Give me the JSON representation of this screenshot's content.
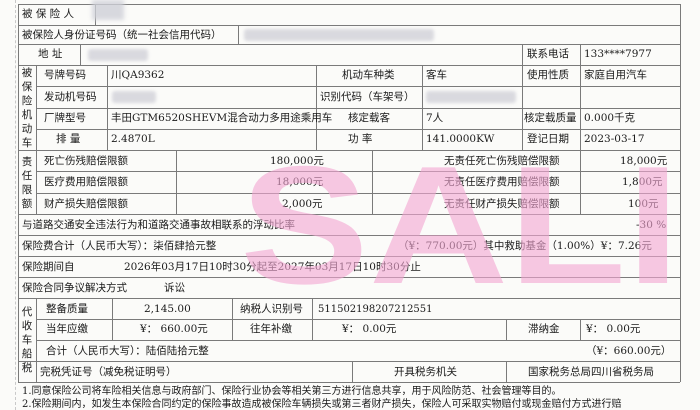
{
  "header": {
    "insured_label": "被 保 险 人",
    "id_label": "被保险人身份证号码（统一社会信用代码）",
    "address_label": "地    址",
    "phone_label": "联系电话",
    "phone_value": "133****7977"
  },
  "vehicle": {
    "section_label": "被保险机动车",
    "plate_label": "号牌号码",
    "plate_value": "川QA9362",
    "kind_label": "机动车种类",
    "kind_value": "客车",
    "use_label": "使用性质",
    "use_value": "家庭自用汽车",
    "engine_label": "发动机号码",
    "vin_label": "识别代码（车架号）",
    "model_label": "厂牌型号",
    "model_value": "丰田GTM6520SHEVM混合动力多用途乘用车",
    "seats_label": "核定载客",
    "seats_value": "7人",
    "load_label": "核定载质量",
    "load_value": "0.000千克",
    "displacement_label": "排    量",
    "displacement_value": "2.4870L",
    "power_label": "功    率",
    "power_value": "141.0000KW",
    "reg_date_label": "登记日期",
    "reg_date_value": "2023-03-17"
  },
  "liability": {
    "section_label": "责任限额",
    "rows": [
      {
        "label": "死亡伤残赔偿限额",
        "value": "180,000元",
        "nf_label": "无责任死亡伤残赔偿限额",
        "nf_value": "18,000元"
      },
      {
        "label": "医疗费用赔偿限额",
        "value": "18,000元",
        "nf_label": "无责任医疗费用赔偿限额",
        "nf_value": "1,800元"
      },
      {
        "label": "财产损失赔偿限额",
        "value": "2,000元",
        "nf_label": "无责任财产损失赔偿限额",
        "nf_value": "100元"
      }
    ]
  },
  "float_rate": {
    "label": "与道路交通安全违法行为和道路交通事故相联系的浮动比率",
    "value": "-30  %"
  },
  "premium": {
    "label": "保险费合计（人民币大写）：柒佰肆拾元整",
    "amount": "（¥：770.00元）其中救助基金（1.00%）¥：7.26元"
  },
  "period": {
    "label": "保险期间自",
    "value": "2026年03月17日10时30分起至2027年03月17日10时30分止"
  },
  "dispute": {
    "label": "保险合同争议解决方式",
    "value": "诉讼"
  },
  "tax": {
    "section_label": "代收车船税",
    "tonnage_label": "整备质量",
    "tonnage_value": "2,145.00",
    "taxpayer_label": "纳税人识别号",
    "taxpayer_value": "511502198207212551",
    "current_label": "当年应缴",
    "current_value": "¥：  660.00元",
    "back_label": "往年补缴",
    "back_value": "¥：      0.00元",
    "late_label": "滞纳金",
    "late_value": "¥：       0.00元",
    "total_label": "合计（人民币大写）：陆佰陆拾元整",
    "total_value": "（¥：660.00元）",
    "cert_label": "完税凭证号（减免税证明号）",
    "office_label": "开具税务机关",
    "office_value": "国家税务总局四川省税务局"
  },
  "notes": [
    "1.同意保险公司将车险相关信息与政府部门、保险行业协会等相关第三方进行信息共享，用于风险防范、社会管理等目的。",
    "2.保险期间内，如发生本保险合同约定的保险事故造成被保险车辆损失或第三者财产损失，保险人可采取实物赔付或现金赔付方式进行赔"
  ],
  "watermark": "SALI",
  "colors": {
    "watermark": "#f2a7d2",
    "rule": "#7a7a7a"
  }
}
